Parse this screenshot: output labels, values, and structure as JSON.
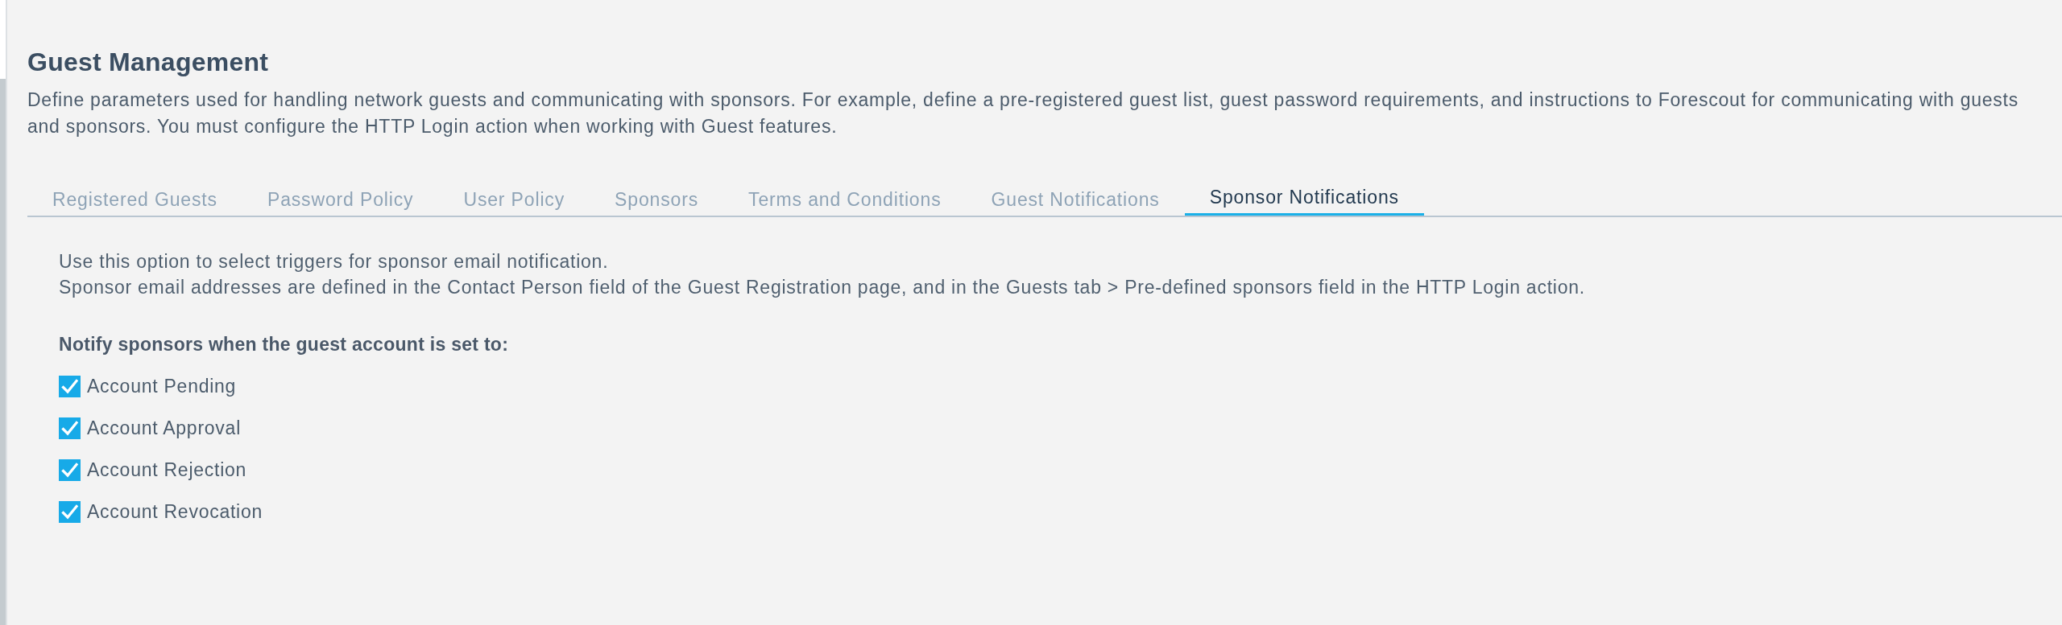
{
  "page": {
    "title": "Guest Management",
    "description": "Define parameters used for handling network guests and communicating with sponsors. For example, define a pre-registered guest list, guest password requirements, and instructions to Forescout for communicating with guests and sponsors. You must configure the HTTP Login action when working with Guest features."
  },
  "tabs": [
    {
      "label": "Registered Guests",
      "selected": false
    },
    {
      "label": "Password Policy",
      "selected": false
    },
    {
      "label": "User Policy",
      "selected": false
    },
    {
      "label": "Sponsors",
      "selected": false
    },
    {
      "label": "Terms and Conditions",
      "selected": false
    },
    {
      "label": "Guest Notifications",
      "selected": false
    },
    {
      "label": "Sponsor Notifications",
      "selected": true
    }
  ],
  "panel": {
    "intro_lines": [
      "Use this option to select triggers for sponsor email notification.",
      "Sponsor email addresses are defined in the Contact Person field of the Guest Registration page, and in the Guests tab > Pre-defined sponsors field in the HTTP Login action."
    ],
    "heading": "Notify sponsors when the guest account is set to:",
    "options": [
      {
        "label": "Account Pending",
        "checked": true
      },
      {
        "label": "Account Approval",
        "checked": true
      },
      {
        "label": "Account Rejection",
        "checked": true
      },
      {
        "label": "Account Revocation",
        "checked": true
      }
    ]
  }
}
